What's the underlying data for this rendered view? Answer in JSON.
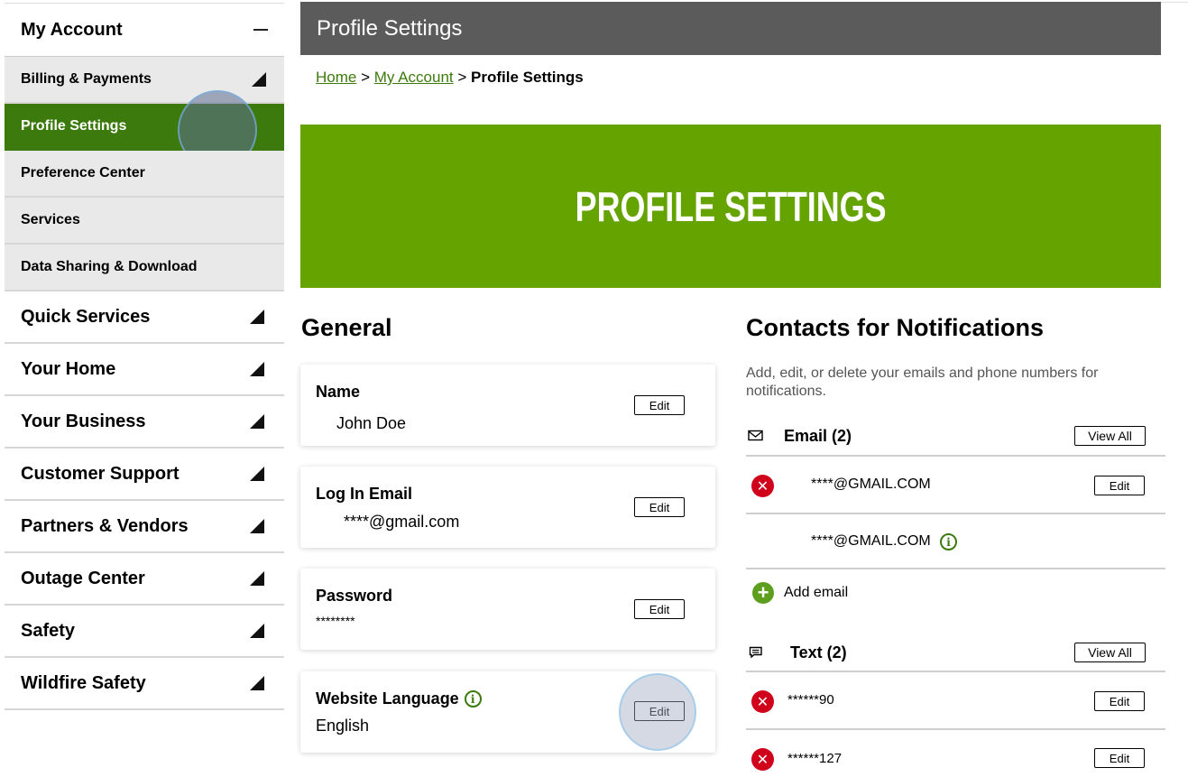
{
  "sidebar": {
    "header": "My Account",
    "subitems": [
      "Billing & Payments",
      "Profile Settings",
      "Preference Center",
      "Services",
      "Data Sharing & Download"
    ],
    "items": [
      "Quick Services",
      "Your Home",
      "Your Business",
      "Customer Support",
      "Partners & Vendors",
      "Outage Center",
      "Safety",
      "Wildfire Safety"
    ]
  },
  "topbar": {
    "title": "Profile Settings"
  },
  "breadcrumb": {
    "home": "Home",
    "account": "My Account",
    "current": "Profile Settings",
    "sep": ">"
  },
  "banner": {
    "title": "PROFILE SETTINGS"
  },
  "general": {
    "heading": "General",
    "cards": [
      {
        "label": "Name",
        "value": "John Doe",
        "edit": "Edit"
      },
      {
        "label": "Log In Email",
        "value": "****@gmail.com",
        "edit": "Edit"
      },
      {
        "label": "Password",
        "value": "********",
        "edit": "Edit"
      },
      {
        "label": "Website Language",
        "value": "English",
        "edit": "Edit"
      }
    ]
  },
  "contacts": {
    "heading": "Contacts for Notifications",
    "description": "Add, edit, or delete your emails and phone numbers for notifications.",
    "email": {
      "title": "Email (2)",
      "view_all": "View All",
      "rows": [
        {
          "value": "****@GMAIL.COM",
          "edit": "Edit"
        },
        {
          "value": "****@GMAIL.COM"
        }
      ],
      "add": "Add email"
    },
    "text": {
      "title": "Text (2)",
      "view_all": "View All",
      "rows": [
        {
          "value": "******90",
          "edit": "Edit"
        },
        {
          "value": "******127",
          "edit": "Edit"
        }
      ]
    }
  }
}
